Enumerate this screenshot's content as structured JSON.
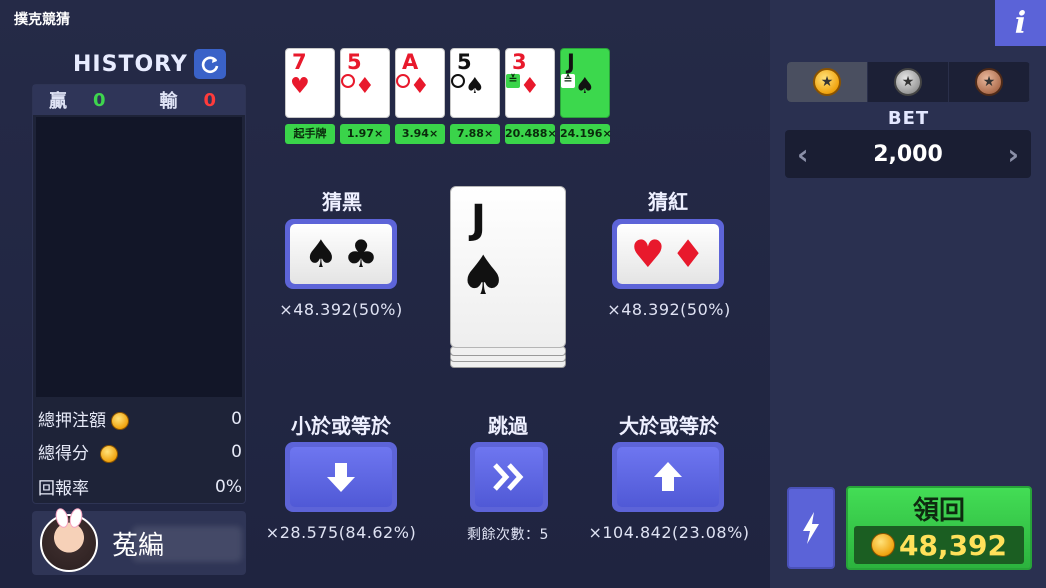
{
  "app": {
    "title": "撲克競猜"
  },
  "history": {
    "title": "HISTORY",
    "win_label": "贏",
    "win_count": "0",
    "lose_label": "輸",
    "lose_count": "0",
    "stats": [
      {
        "label": "總押注額",
        "value": "0",
        "has_coin": true
      },
      {
        "label": "總得分",
        "value": "0",
        "has_coin": true
      },
      {
        "label": "回報率",
        "value": "0%",
        "has_coin": false
      }
    ]
  },
  "player": {
    "name": "菟編"
  },
  "card_history": [
    {
      "rank": "7",
      "suit": "♥",
      "color": "red",
      "mark": "",
      "multiplier": "起手牌"
    },
    {
      "rank": "5",
      "suit": "♦",
      "color": "red",
      "mark": "O",
      "multiplier": "1.97×"
    },
    {
      "rank": "A",
      "suit": "♦",
      "color": "red",
      "mark": "O",
      "multiplier": "3.94×"
    },
    {
      "rank": "5",
      "suit": "♠",
      "color": "black",
      "mark": "O",
      "multiplier": "7.88×"
    },
    {
      "rank": "3",
      "suit": "♦",
      "color": "red",
      "mark": "≚",
      "multiplier": "20.488×"
    },
    {
      "rank": "J",
      "suit": "♠",
      "color": "black",
      "mark": "≙",
      "multiplier": "24.196×"
    }
  ],
  "current_card": {
    "rank": "J",
    "suit": "♠"
  },
  "guesses": {
    "black": {
      "label": "猜黑",
      "suits": [
        "♠",
        "♣"
      ],
      "multiplier": "×48.392(50%)"
    },
    "red": {
      "label": "猜紅",
      "suits": [
        "♥",
        "♦"
      ],
      "multiplier": "×48.392(50%)"
    },
    "lower": {
      "label": "小於或等於",
      "multiplier": "×28.575(84.62%)"
    },
    "skip": {
      "label": "跳過",
      "remaining": "剩餘次數：5"
    },
    "higher": {
      "label": "大於或等於",
      "multiplier": "×104.842(23.08%)"
    }
  },
  "right_panel": {
    "info_label": "i",
    "coin_tabs": [
      "gold",
      "silver",
      "bronze"
    ],
    "bet_label": "BET",
    "bet_value": "2,000",
    "collect_label": "領回",
    "collect_amount": "48,392"
  },
  "colors": {
    "accent": "#5d64d8",
    "win": "#3ed64e",
    "lose": "#ff3b3b",
    "collect": "#36c848"
  }
}
